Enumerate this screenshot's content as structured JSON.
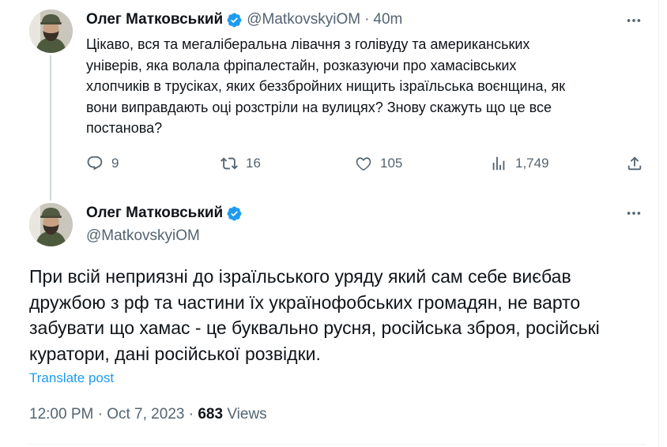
{
  "tweet1": {
    "author_name": "Олег Матковський",
    "handle": "@MatkovskyiOM",
    "separator": "·",
    "time": "40m",
    "text": "Цікаво, вся та мегаліберальна лівачня з голівуду та американських\nуніверів, яка волала фріпалестайн, розказуючи про хамасівських\nхлопчиків в трусіках, яких беззбройних нищить ізраїльська воєнщина, як\nвони виправдають оці розстріли на вулицях? Знову скажуть що це все\nпостанова?",
    "replies": "9",
    "reposts": "16",
    "likes": "105",
    "views": "1,749"
  },
  "tweet2": {
    "author_name": "Олег Матковський",
    "handle": "@MatkovskyiOM",
    "text": "При всій неприязні до ізраїльського уряду який сам себе виєбав\nдружбою з рф та частини їх українофобських громадян, не варто\nзабувати що хамас - це буквально русня, російська зброя, російські\nкуратори, дані російської розвідки.",
    "translate_label": "Translate post",
    "time": "12:00 PM",
    "separator": "·",
    "date": "Oct 7, 2023",
    "views_count": "683",
    "views_label": "Views"
  },
  "colors": {
    "verified": "#1d9bf0",
    "link": "#1d9bf0",
    "secondary_text": "#536471"
  },
  "icons": [
    "verified-badge-icon",
    "more-icon",
    "reply-icon",
    "repost-icon",
    "like-icon",
    "views-icon",
    "share-icon"
  ]
}
